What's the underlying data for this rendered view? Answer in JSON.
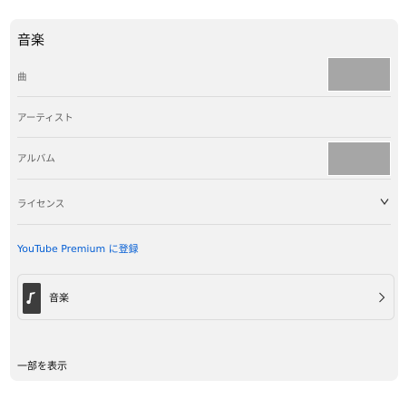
{
  "section": {
    "title": "音楽"
  },
  "rows": {
    "song_label": "曲",
    "artist_label": "アーティスト",
    "album_label": "アルバム",
    "license_label": "ライセンス"
  },
  "premium": {
    "link_text": "YouTube Premium に登録"
  },
  "music_card": {
    "label": "音楽",
    "icon": "music-note-icon"
  },
  "footer": {
    "show_less_label": "一部を表示"
  },
  "colors": {
    "panel_bg": "#f2f2f2",
    "thumb_placeholder": "#a6a6a6",
    "link": "#065fd4",
    "divider": "#dcdcdc"
  }
}
